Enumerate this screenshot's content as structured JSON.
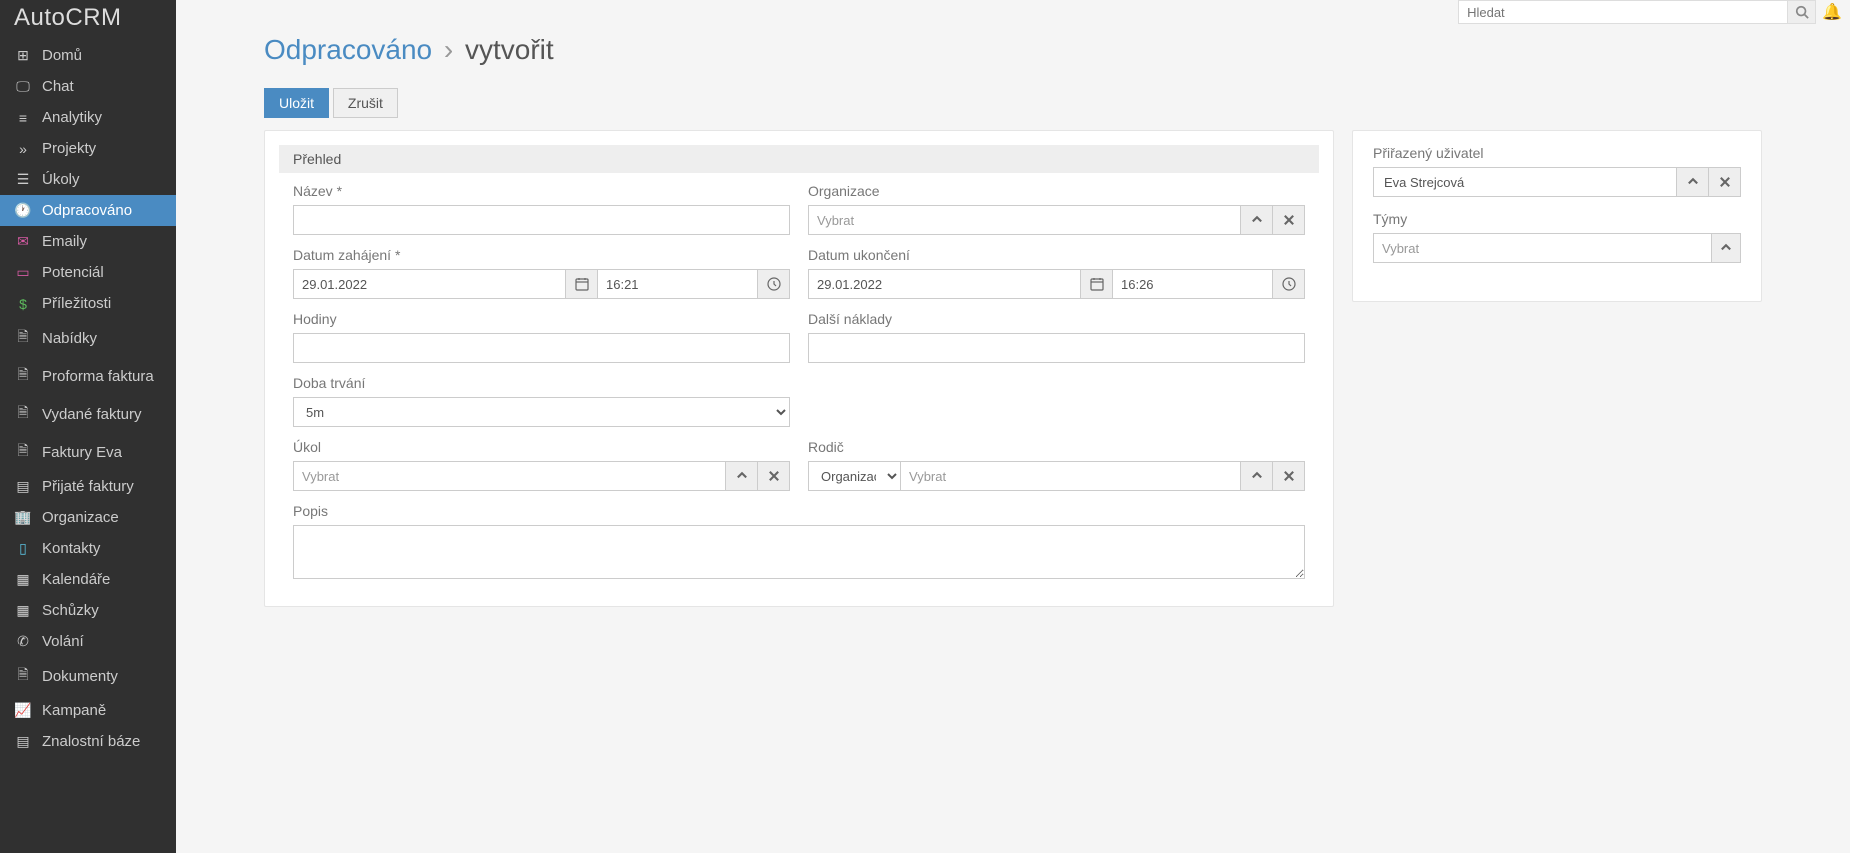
{
  "app": {
    "logo": "AutoCRM"
  },
  "topbar": {
    "search_placeholder": "Hledat"
  },
  "sidebar": {
    "items": [
      {
        "label": "Domů",
        "active": false
      },
      {
        "label": "Chat",
        "active": false
      },
      {
        "label": "Analytiky",
        "active": false
      },
      {
        "label": "Projekty",
        "active": false
      },
      {
        "label": "Úkoly",
        "active": false
      },
      {
        "label": "Odpracováno",
        "active": true
      },
      {
        "label": "Emaily",
        "active": false
      },
      {
        "label": "Potenciál",
        "active": false
      },
      {
        "label": "Příležitosti",
        "active": false
      },
      {
        "label": "Nabídky",
        "active": false
      },
      {
        "label": "Proforma faktura",
        "active": false
      },
      {
        "label": "Vydané faktury",
        "active": false
      },
      {
        "label": "Faktury Eva",
        "active": false
      },
      {
        "label": "Přijaté faktury",
        "active": false
      },
      {
        "label": "Organizace",
        "active": false
      },
      {
        "label": "Kontakty",
        "active": false
      },
      {
        "label": "Kalendáře",
        "active": false
      },
      {
        "label": "Schůzky",
        "active": false
      },
      {
        "label": "Volání",
        "active": false
      },
      {
        "label": "Dokumenty",
        "active": false
      },
      {
        "label": "Kampaně",
        "active": false
      },
      {
        "label": "Znalostní báze",
        "active": false
      }
    ]
  },
  "breadcrumb": {
    "parent": "Odpracováno",
    "sep": "›",
    "current": "vytvořit"
  },
  "buttons": {
    "save": "Uložit",
    "cancel": "Zrušit"
  },
  "section": {
    "overview": "Přehled"
  },
  "labels": {
    "name": "Název *",
    "organization": "Organizace",
    "date_start": "Datum zahájení *",
    "date_end": "Datum ukončení",
    "hours": "Hodiny",
    "other_costs": "Další náklady",
    "duration": "Doba trvání",
    "task": "Úkol",
    "parent": "Rodič",
    "description": "Popis",
    "assigned_user": "Přiřazený uživatel",
    "teams": "Týmy"
  },
  "values": {
    "name": "",
    "organization_placeholder": "Vybrat",
    "date_start": "29.01.2022",
    "time_start": "16:21",
    "date_end": "29.01.2022",
    "time_end": "16:26",
    "hours": "",
    "other_costs": "",
    "duration": "5m",
    "task_placeholder": "Vybrat",
    "parent_type": "Organizace",
    "parent_placeholder": "Vybrat",
    "description": "",
    "assigned_user": "Eva Strejcová",
    "teams_placeholder": "Vybrat"
  }
}
